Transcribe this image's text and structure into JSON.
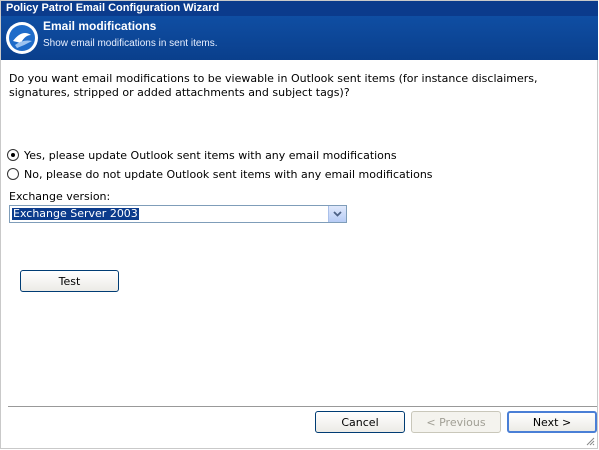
{
  "window": {
    "title": "Policy Patrol Email Configuration Wizard"
  },
  "header": {
    "title": "Email modifications",
    "subtitle": "Show email modifications in sent items."
  },
  "question": "Do you want email modifications to be viewable in Outlook sent items (for instance disclaimers, signatures, stripped or added attachments and subject tags)?",
  "options": [
    {
      "label": "Yes, please update Outlook sent items with any email modifications",
      "checked": true
    },
    {
      "label": "No, please do not update Outlook sent items with any email modifications",
      "checked": false
    }
  ],
  "exchange": {
    "label": "Exchange version:",
    "selected": "Exchange Server 2003"
  },
  "buttons": {
    "test": "Test",
    "cancel": "Cancel",
    "previous": "< Previous",
    "next": "Next >"
  },
  "colors": {
    "titlebar": "#0b3b8c",
    "header": "#0f4ea3",
    "selection": "#0b3b8c"
  }
}
